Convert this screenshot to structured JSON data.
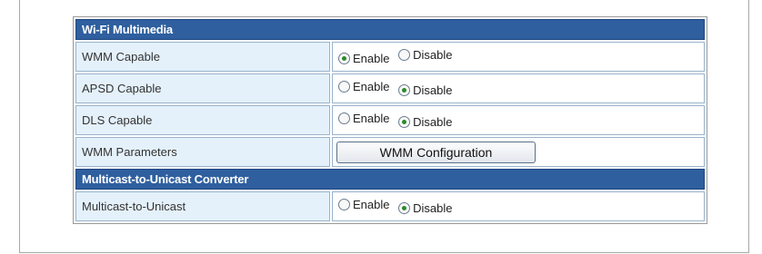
{
  "sections": [
    {
      "title": "Wi-Fi Multimedia",
      "rows": [
        {
          "label": "WMM Capable",
          "options": [
            "Enable",
            "Disable"
          ],
          "selected": "Enable"
        },
        {
          "label": "APSD Capable",
          "options": [
            "Enable",
            "Disable"
          ],
          "selected": "Disable"
        },
        {
          "label": "DLS Capable",
          "options": [
            "Enable",
            "Disable"
          ],
          "selected": "Disable"
        },
        {
          "label": "WMM Parameters",
          "button": "WMM Configuration"
        }
      ]
    },
    {
      "title": "Multicast-to-Unicast Converter",
      "rows": [
        {
          "label": "Multicast-to-Unicast",
          "options": [
            "Enable",
            "Disable"
          ],
          "selected": "Disable"
        }
      ]
    }
  ],
  "colors": {
    "section_header": "#2f5f9f",
    "label_cell": "#e4f1fb",
    "radio_checked": "#2a8a2a"
  }
}
